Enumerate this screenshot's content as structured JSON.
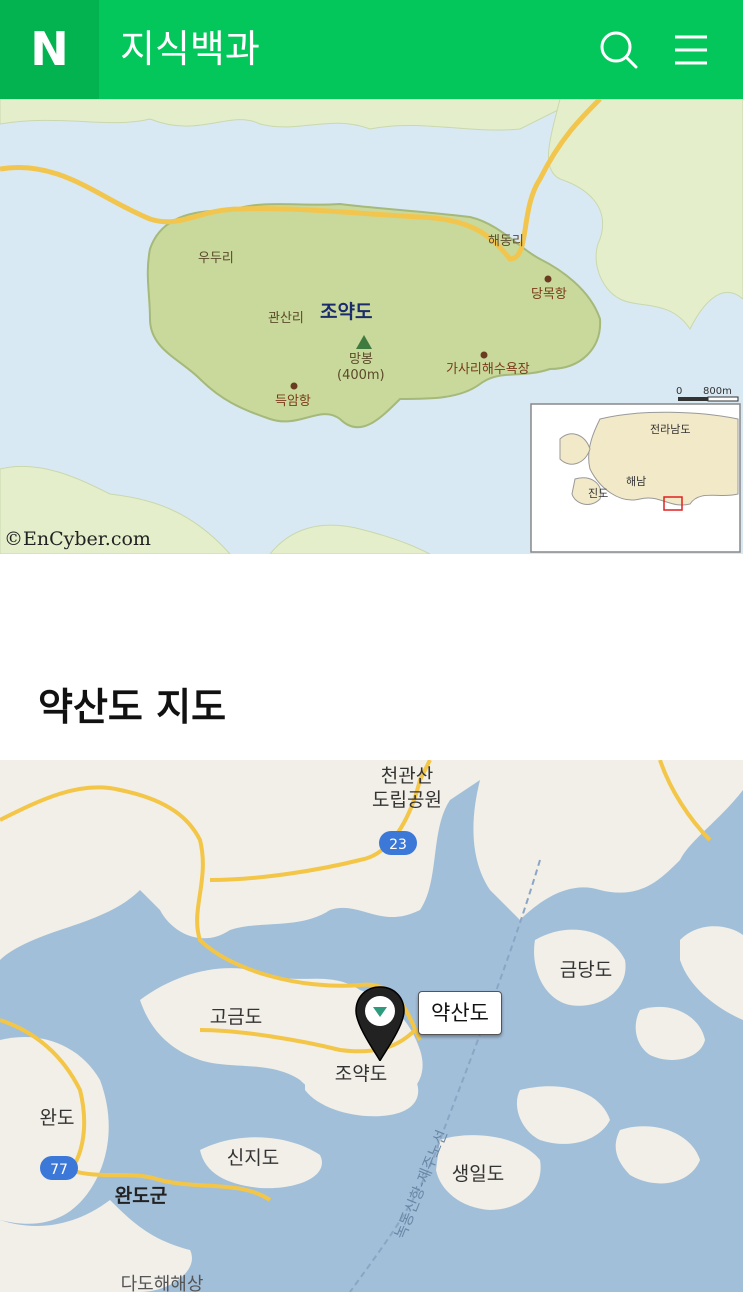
{
  "header": {
    "logo": "N",
    "title": "지식백과",
    "search_icon": "search-icon",
    "menu_icon": "menu-icon",
    "brand_color": "#03c75a"
  },
  "map1": {
    "labels": {
      "island": "조약도",
      "village_udu": "우두리",
      "village_haedong": "해동리",
      "port_dangmok": "당목항",
      "village_gwansan": "관산리",
      "peak_name": "망봉",
      "peak_height": "(400m)",
      "beach": "가사리해수욕장",
      "port_deukam": "득암항"
    },
    "scale": {
      "zero": "0",
      "distance": "800m"
    },
    "inset": {
      "province": "전라남도",
      "jindo": "진도",
      "haenam": "해남"
    },
    "copyright": "©EnCyber.com"
  },
  "section": {
    "title": "약산도 지도"
  },
  "map2": {
    "labels": {
      "park_line1": "천관산",
      "park_line2": "도립공원",
      "route_23": "23",
      "geumdangdo": "금당도",
      "gogeumdo": "고금도",
      "joyakdo": "조약도",
      "wando": "완도",
      "route_77": "77",
      "wando_gun": "완도군",
      "sinjido": "신지도",
      "saengildo": "생일도",
      "sea_park": "다도해해상",
      "ferry_route": "녹동신항-제주노선"
    },
    "pin_label": "약산도",
    "colors": {
      "water": "#a2bfd9",
      "land": "#f1efe7",
      "road": "#f3c648"
    }
  }
}
